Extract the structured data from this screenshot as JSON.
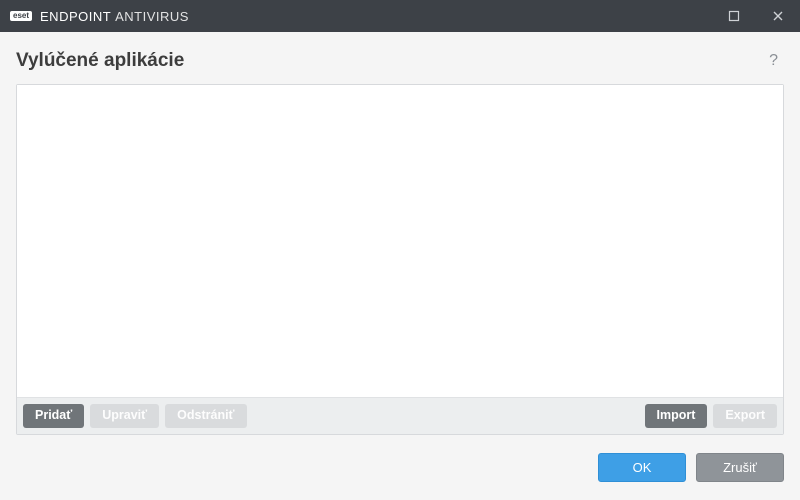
{
  "titlebar": {
    "badge": "eset",
    "product_strong": "ENDPOINT",
    "product_light": "ANTIVIRUS"
  },
  "page": {
    "title": "Vylúčené aplikácie",
    "help_symbol": "?"
  },
  "toolbar": {
    "add_label": "Pridať",
    "edit_label": "Upraviť",
    "remove_label": "Odstrániť",
    "import_label": "Import",
    "export_label": "Export"
  },
  "footer": {
    "ok_label": "OK",
    "cancel_label": "Zrušiť"
  }
}
